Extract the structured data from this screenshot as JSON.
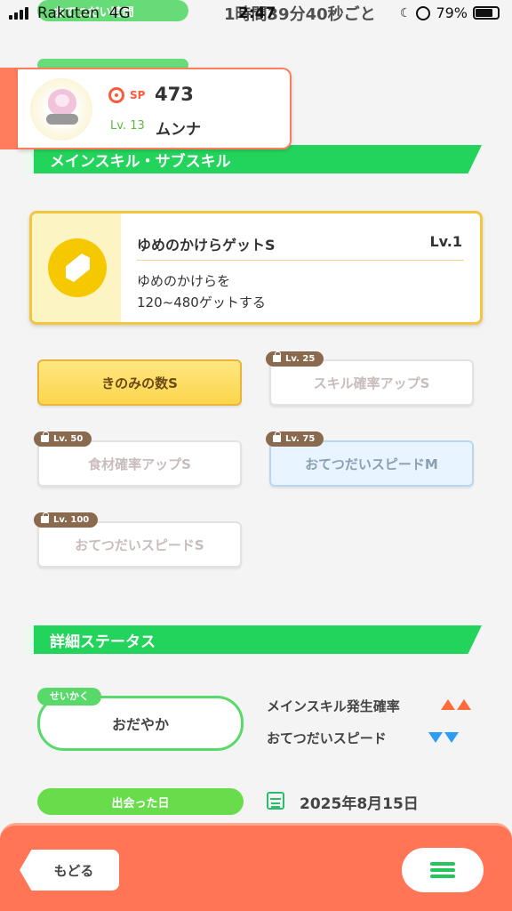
{
  "status_bar": {
    "carrier": "Rakuten",
    "network": "4G",
    "time": "2:47",
    "battery": "79%"
  },
  "background_rows": {
    "row1_label": "おてつだい時間",
    "row1_value": "1時間39分40秒ごと",
    "row2_label": "",
    "row2_value": ""
  },
  "pokemon": {
    "sp_label": "SP",
    "sp_value": "473",
    "level": "Lv. 13",
    "name": "ムンナ"
  },
  "sections": {
    "skills_title": "メインスキル・サブスキル",
    "details_title": "詳細ステータス"
  },
  "main_skill": {
    "name": "ゆめのかけらゲットS",
    "level": "Lv.1",
    "description": "ゆめのかけらを\n120~480ゲットする"
  },
  "sub_skills": [
    {
      "label": "きのみの数S",
      "unlock": "",
      "style": "gold"
    },
    {
      "label": "スキル確率アップS",
      "unlock": "Lv. 25",
      "style": "white"
    },
    {
      "label": "食材確率アップS",
      "unlock": "Lv. 50",
      "style": "white"
    },
    {
      "label": "おてつだいスピードM",
      "unlock": "Lv. 75",
      "style": "blue"
    },
    {
      "label": "おてつだいスピードS",
      "unlock": "Lv. 100",
      "style": "white"
    }
  ],
  "nature": {
    "tag": "せいかく",
    "value": "おだやか",
    "up_effect": "メインスキル発生確率",
    "down_effect": "おてつだいスピード"
  },
  "met": {
    "label": "出会った日",
    "date": "2025年8月15日"
  },
  "bottom": {
    "back_label": "もどる"
  },
  "colors": {
    "accent_green": "#23d45c",
    "header_orange": "#ff7556",
    "gold": "#f3c640",
    "up_arrow": "#ff6a3a",
    "down_arrow": "#2d9cf5"
  }
}
